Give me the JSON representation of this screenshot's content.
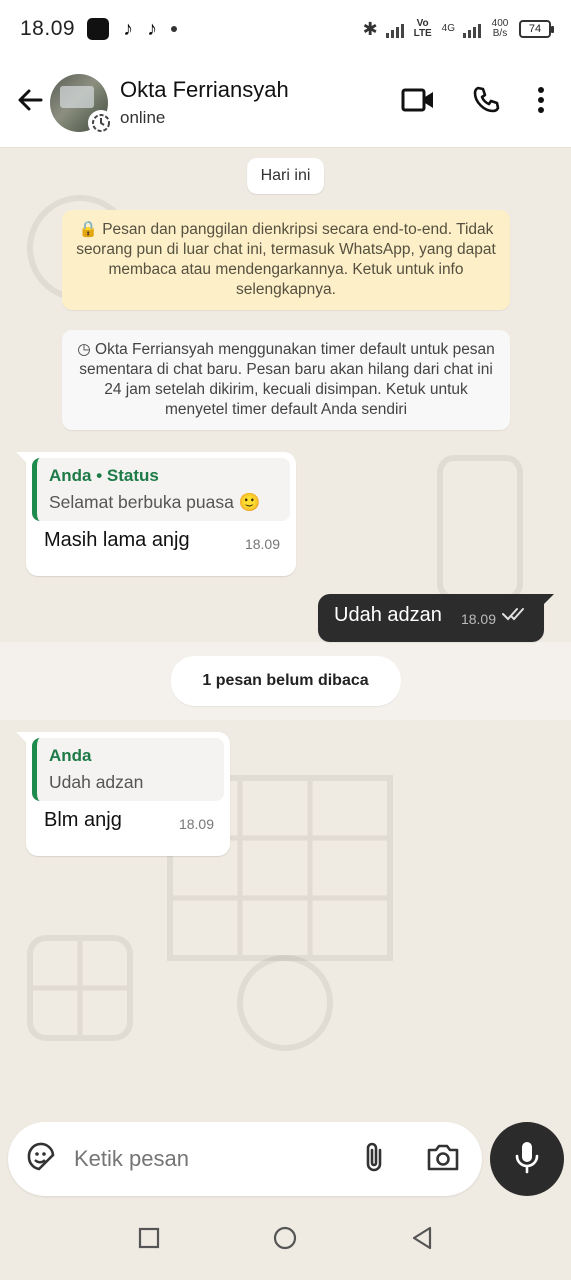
{
  "status_bar": {
    "time": "18.09",
    "network": "Vo LTE",
    "network_type": "4G",
    "speed_value": "400",
    "speed_unit": "B/s",
    "battery": "74"
  },
  "header": {
    "contact_name": "Okta Ferriansyah",
    "contact_status": "online",
    "icons": [
      "back-arrow-icon",
      "video-call-icon",
      "phone-icon",
      "more-options-icon"
    ]
  },
  "chat": {
    "date_label": "Hari ini",
    "encryption_notice": "🔒 Pesan dan panggilan dienkripsi secara end-to-end. Tidak seorang pun di luar chat ini, termasuk WhatsApp, yang dapat membaca atau mendengarkannya. Ketuk untuk info selengkapnya.",
    "timer_notice": "◷ Okta Ferriansyah menggunakan timer default untuk pesan sementara di chat baru. Pesan baru akan hilang dari chat ini 24 jam setelah dikirim, kecuali disimpan. Ketuk untuk menyetel timer default Anda sendiri",
    "messages": [
      {
        "direction": "in",
        "quote_author": "Anda • Status",
        "quote_text": "Selamat berbuka puasa 🙂",
        "text": "Masih lama anjg",
        "time": "18.09"
      },
      {
        "direction": "out",
        "text": "Udah adzan",
        "time": "18.09",
        "read": true
      },
      {
        "direction": "in",
        "quote_author": "Anda",
        "quote_text": "Udah adzan",
        "text": "Blm anjg",
        "time": "18.09"
      }
    ],
    "unread_label": "1 pesan belum dibaca"
  },
  "input": {
    "placeholder": "Ketik pesan"
  },
  "colors": {
    "chat_background": "#efeae2",
    "quote_accent": "#1e8b4c",
    "outgoing_bubble": "#2c2c2c",
    "encryption_notice_bg": "#fdf0c9"
  }
}
